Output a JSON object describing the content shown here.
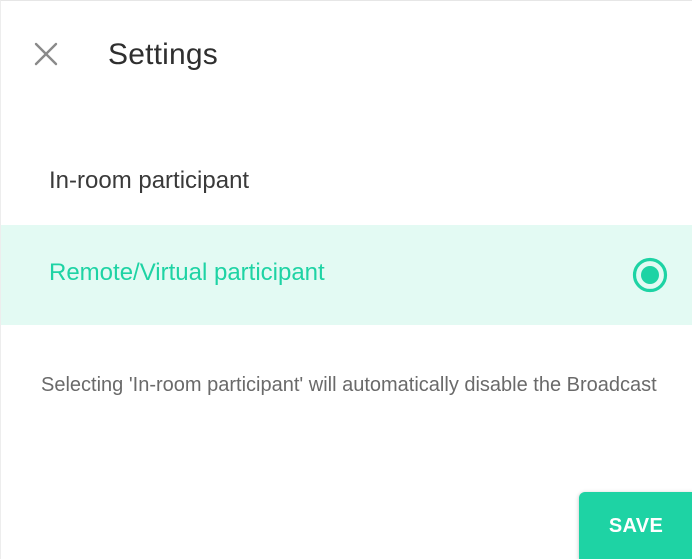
{
  "header": {
    "title": "Settings",
    "close_icon": "close-icon"
  },
  "options": [
    {
      "label": "In-room participant",
      "selected": false
    },
    {
      "label": "Remote/Virtual participant",
      "selected": true
    }
  ],
  "note": "Selecting 'In-room participant' will automatically disable the Broadcast",
  "footer": {
    "save_label": "SAVE"
  },
  "colors": {
    "accent": "#1ed3a4",
    "selected_row_bg": "#e3faf3",
    "close_icon": "#8a8a8a"
  }
}
